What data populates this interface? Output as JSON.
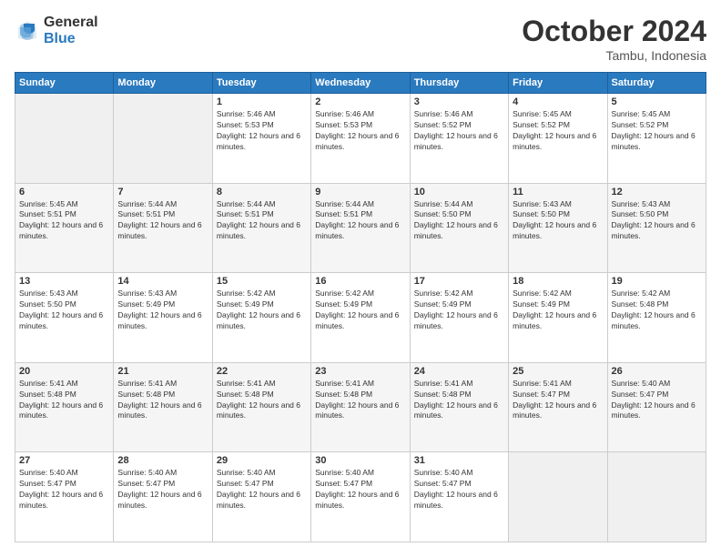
{
  "logo": {
    "general": "General",
    "blue": "Blue"
  },
  "header": {
    "month": "October 2024",
    "location": "Tambu, Indonesia"
  },
  "days_of_week": [
    "Sunday",
    "Monday",
    "Tuesday",
    "Wednesday",
    "Thursday",
    "Friday",
    "Saturday"
  ],
  "weeks": [
    [
      {
        "day": null
      },
      {
        "day": null
      },
      {
        "day": "1",
        "sunrise": "Sunrise: 5:46 AM",
        "sunset": "Sunset: 5:53 PM",
        "daylight": "Daylight: 12 hours and 6 minutes."
      },
      {
        "day": "2",
        "sunrise": "Sunrise: 5:46 AM",
        "sunset": "Sunset: 5:53 PM",
        "daylight": "Daylight: 12 hours and 6 minutes."
      },
      {
        "day": "3",
        "sunrise": "Sunrise: 5:46 AM",
        "sunset": "Sunset: 5:52 PM",
        "daylight": "Daylight: 12 hours and 6 minutes."
      },
      {
        "day": "4",
        "sunrise": "Sunrise: 5:45 AM",
        "sunset": "Sunset: 5:52 PM",
        "daylight": "Daylight: 12 hours and 6 minutes."
      },
      {
        "day": "5",
        "sunrise": "Sunrise: 5:45 AM",
        "sunset": "Sunset: 5:52 PM",
        "daylight": "Daylight: 12 hours and 6 minutes."
      }
    ],
    [
      {
        "day": "6",
        "sunrise": "Sunrise: 5:45 AM",
        "sunset": "Sunset: 5:51 PM",
        "daylight": "Daylight: 12 hours and 6 minutes."
      },
      {
        "day": "7",
        "sunrise": "Sunrise: 5:44 AM",
        "sunset": "Sunset: 5:51 PM",
        "daylight": "Daylight: 12 hours and 6 minutes."
      },
      {
        "day": "8",
        "sunrise": "Sunrise: 5:44 AM",
        "sunset": "Sunset: 5:51 PM",
        "daylight": "Daylight: 12 hours and 6 minutes."
      },
      {
        "day": "9",
        "sunrise": "Sunrise: 5:44 AM",
        "sunset": "Sunset: 5:51 PM",
        "daylight": "Daylight: 12 hours and 6 minutes."
      },
      {
        "day": "10",
        "sunrise": "Sunrise: 5:44 AM",
        "sunset": "Sunset: 5:50 PM",
        "daylight": "Daylight: 12 hours and 6 minutes."
      },
      {
        "day": "11",
        "sunrise": "Sunrise: 5:43 AM",
        "sunset": "Sunset: 5:50 PM",
        "daylight": "Daylight: 12 hours and 6 minutes."
      },
      {
        "day": "12",
        "sunrise": "Sunrise: 5:43 AM",
        "sunset": "Sunset: 5:50 PM",
        "daylight": "Daylight: 12 hours and 6 minutes."
      }
    ],
    [
      {
        "day": "13",
        "sunrise": "Sunrise: 5:43 AM",
        "sunset": "Sunset: 5:50 PM",
        "daylight": "Daylight: 12 hours and 6 minutes."
      },
      {
        "day": "14",
        "sunrise": "Sunrise: 5:43 AM",
        "sunset": "Sunset: 5:49 PM",
        "daylight": "Daylight: 12 hours and 6 minutes."
      },
      {
        "day": "15",
        "sunrise": "Sunrise: 5:42 AM",
        "sunset": "Sunset: 5:49 PM",
        "daylight": "Daylight: 12 hours and 6 minutes."
      },
      {
        "day": "16",
        "sunrise": "Sunrise: 5:42 AM",
        "sunset": "Sunset: 5:49 PM",
        "daylight": "Daylight: 12 hours and 6 minutes."
      },
      {
        "day": "17",
        "sunrise": "Sunrise: 5:42 AM",
        "sunset": "Sunset: 5:49 PM",
        "daylight": "Daylight: 12 hours and 6 minutes."
      },
      {
        "day": "18",
        "sunrise": "Sunrise: 5:42 AM",
        "sunset": "Sunset: 5:49 PM",
        "daylight": "Daylight: 12 hours and 6 minutes."
      },
      {
        "day": "19",
        "sunrise": "Sunrise: 5:42 AM",
        "sunset": "Sunset: 5:48 PM",
        "daylight": "Daylight: 12 hours and 6 minutes."
      }
    ],
    [
      {
        "day": "20",
        "sunrise": "Sunrise: 5:41 AM",
        "sunset": "Sunset: 5:48 PM",
        "daylight": "Daylight: 12 hours and 6 minutes."
      },
      {
        "day": "21",
        "sunrise": "Sunrise: 5:41 AM",
        "sunset": "Sunset: 5:48 PM",
        "daylight": "Daylight: 12 hours and 6 minutes."
      },
      {
        "day": "22",
        "sunrise": "Sunrise: 5:41 AM",
        "sunset": "Sunset: 5:48 PM",
        "daylight": "Daylight: 12 hours and 6 minutes."
      },
      {
        "day": "23",
        "sunrise": "Sunrise: 5:41 AM",
        "sunset": "Sunset: 5:48 PM",
        "daylight": "Daylight: 12 hours and 6 minutes."
      },
      {
        "day": "24",
        "sunrise": "Sunrise: 5:41 AM",
        "sunset": "Sunset: 5:48 PM",
        "daylight": "Daylight: 12 hours and 6 minutes."
      },
      {
        "day": "25",
        "sunrise": "Sunrise: 5:41 AM",
        "sunset": "Sunset: 5:47 PM",
        "daylight": "Daylight: 12 hours and 6 minutes."
      },
      {
        "day": "26",
        "sunrise": "Sunrise: 5:40 AM",
        "sunset": "Sunset: 5:47 PM",
        "daylight": "Daylight: 12 hours and 6 minutes."
      }
    ],
    [
      {
        "day": "27",
        "sunrise": "Sunrise: 5:40 AM",
        "sunset": "Sunset: 5:47 PM",
        "daylight": "Daylight: 12 hours and 6 minutes."
      },
      {
        "day": "28",
        "sunrise": "Sunrise: 5:40 AM",
        "sunset": "Sunset: 5:47 PM",
        "daylight": "Daylight: 12 hours and 6 minutes."
      },
      {
        "day": "29",
        "sunrise": "Sunrise: 5:40 AM",
        "sunset": "Sunset: 5:47 PM",
        "daylight": "Daylight: 12 hours and 6 minutes."
      },
      {
        "day": "30",
        "sunrise": "Sunrise: 5:40 AM",
        "sunset": "Sunset: 5:47 PM",
        "daylight": "Daylight: 12 hours and 6 minutes."
      },
      {
        "day": "31",
        "sunrise": "Sunrise: 5:40 AM",
        "sunset": "Sunset: 5:47 PM",
        "daylight": "Daylight: 12 hours and 6 minutes."
      },
      {
        "day": null
      },
      {
        "day": null
      }
    ]
  ]
}
